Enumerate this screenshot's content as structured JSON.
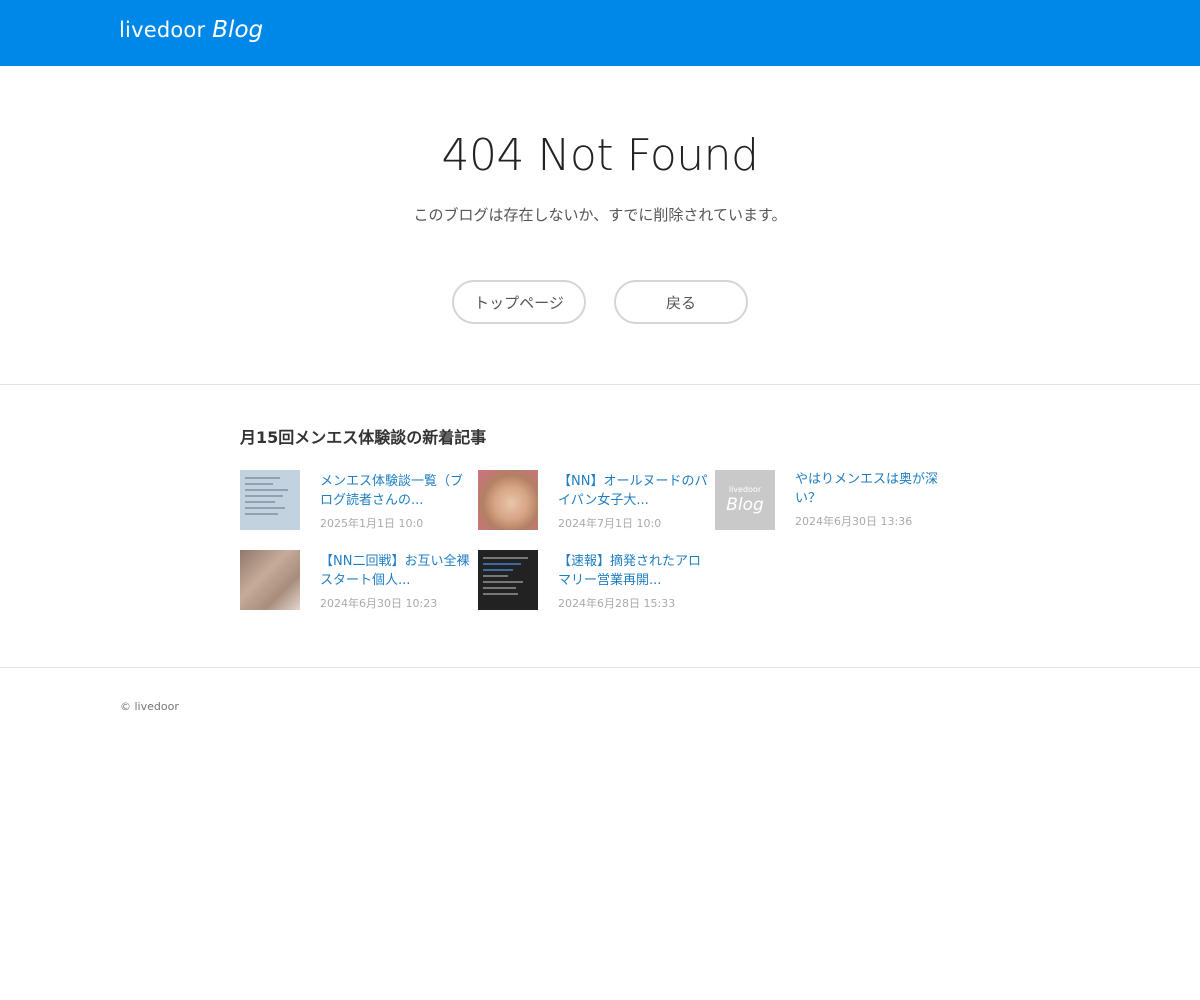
{
  "header": {
    "logo_brand": "livedoor",
    "logo_blog": "Blog",
    "background_color": "#0088e8"
  },
  "error": {
    "title": "404 Not Found",
    "message": "このブログは存在しないか、すでに削除されています。",
    "top_page_button": "トップページ",
    "back_button": "戻る"
  },
  "recent": {
    "heading": "月15回メンエス体験談の新着記事",
    "articles": [
      {
        "title": "メンエス体験談一覧（ブログ読者さんの...",
        "date": "2025年1月1日 10:0"
      },
      {
        "title": "【NN】オールヌードのパイパン女子大...",
        "date": "2024年7月1日 10:0"
      },
      {
        "title": "やはりメンエスは奥が深い？",
        "date": "2024年6月30日 13:36",
        "thumb_brand": "livedoor",
        "thumb_blog": "Blog"
      },
      {
        "title": "【NN二回戦】お互い全裸スタート個人...",
        "date": "2024年6月30日 10:23"
      },
      {
        "title": "【速報】摘発されたアロマリー営業再開...",
        "date": "2024年6月28日 15:33"
      }
    ]
  },
  "footer": {
    "copyright": "© livedoor"
  },
  "link_color": "#1f7ec2"
}
